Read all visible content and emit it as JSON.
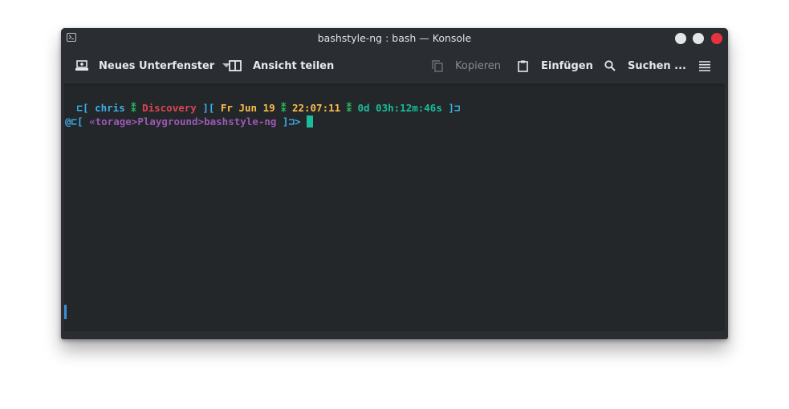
{
  "window": {
    "title": "bashstyle-ng : bash — Konsole",
    "icon": "terminal-app-icon",
    "controls": [
      "minimize-button",
      "maximize-button",
      "close-button"
    ]
  },
  "toolbar": {
    "new_tab_label": "Neues Unterfenster",
    "split_view_label": "Ansicht teilen",
    "copy_label": "Kopieren",
    "paste_label": "Einfügen",
    "search_label": "Suchen ...",
    "menu_icon": "hamburger-menu-icon"
  },
  "terminal": {
    "line1": {
      "open": " ⊏[ ",
      "user": "chris",
      "sep1": " ⁑ ",
      "host": "Discovery",
      "sep2": " ][ ",
      "date": "Fr Jun 19",
      "sep3": " ⁑ ",
      "time": "22:07:11",
      "sep4": " ⁑ ",
      "uptime": "0d 03h:12m:46s",
      "close": " ]⊐"
    },
    "line2": {
      "prefix": "@⊏[ ",
      "path": "«torage>Playground>bashstyle-ng",
      "suffix": " ]⊐> "
    }
  },
  "colors": {
    "bracket": "#3daee9",
    "user": "#3daee9",
    "separator": "#27ae60",
    "host": "#da4453",
    "date": "#fdbc4b",
    "time": "#fdbc4b",
    "uptime": "#1abc9c",
    "path": "#9b59b6",
    "cursor": "#1abc9c",
    "close_button": "#e6333f"
  }
}
